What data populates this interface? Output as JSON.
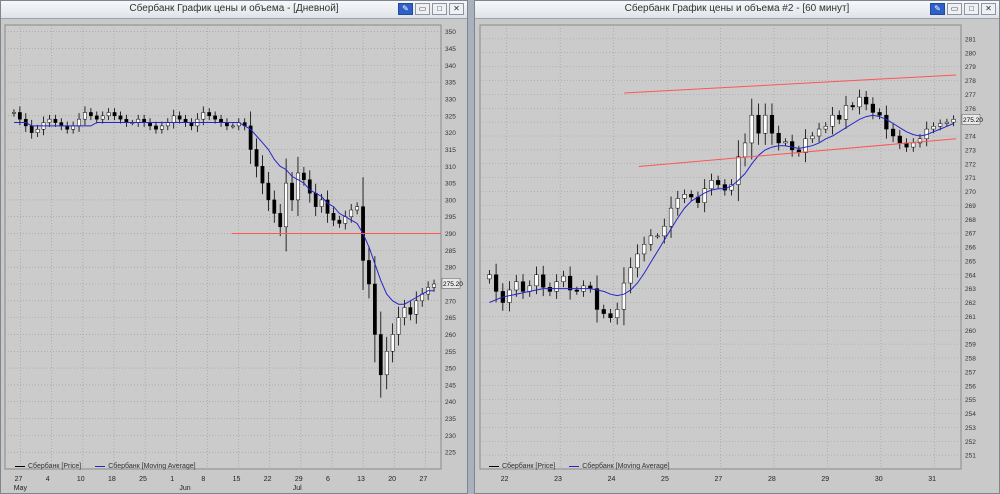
{
  "chart_data": [
    {
      "type": "candlestick",
      "title": "Сбербанк График цены и объема - [Дневной]",
      "ylim": [
        220,
        352
      ],
      "y_ticks": [
        225,
        230,
        235,
        240,
        245,
        250,
        255,
        260,
        265,
        270,
        275,
        280,
        285,
        290,
        295,
        300,
        305,
        310,
        315,
        320,
        325,
        330,
        335,
        340,
        345,
        350
      ],
      "last_value_label": "275.20",
      "x_ticks": [
        "27",
        "4",
        "10",
        "18",
        "25",
        "1",
        "8",
        "15",
        "22",
        "29",
        "6",
        "13",
        "20",
        "27"
      ],
      "x_months": [
        "May",
        "Jun",
        "Jul"
      ],
      "horizontal_line": {
        "y": 290,
        "color": "#ff5555"
      },
      "series": [
        {
          "name": "Сбербанк [Price]",
          "color": "#000000",
          "close": [
            326,
            324,
            322,
            320,
            321,
            323,
            324,
            323,
            322,
            321,
            322,
            324,
            326,
            325,
            324,
            325,
            326,
            325,
            324,
            323,
            323,
            324,
            323,
            322,
            321,
            322,
            323,
            325,
            324,
            323,
            322,
            324,
            326,
            325,
            324,
            323,
            322,
            322,
            323,
            322,
            315,
            310,
            305,
            300,
            296,
            292,
            305,
            300,
            308,
            306,
            302,
            298,
            300,
            296,
            294,
            293,
            295,
            297,
            298,
            282,
            275,
            260,
            248,
            255,
            260,
            265,
            268,
            266,
            270,
            272,
            274,
            275
          ]
        },
        {
          "name": "Сбербанк [Moving Average]",
          "color": "#2525cc",
          "values": [
            323,
            323,
            323,
            322,
            322,
            322,
            322,
            322,
            322,
            322,
            322,
            322,
            322,
            322,
            323,
            323,
            323,
            323,
            323,
            323,
            323,
            323,
            323,
            323,
            323,
            323,
            323,
            323,
            323,
            323,
            323,
            323,
            323,
            323,
            323,
            323,
            323,
            323,
            323,
            322,
            321,
            319,
            317,
            315,
            312,
            310,
            309,
            307,
            306,
            305,
            303,
            302,
            301,
            299,
            298,
            296,
            295,
            294,
            293,
            290,
            286,
            281,
            276,
            272,
            270,
            269,
            269,
            270,
            271,
            272,
            273,
            273
          ]
        }
      ],
      "legend": [
        "Сбербанк [Price]",
        "Сбербанк [Moving Average]"
      ],
      "grid": true
    },
    {
      "type": "candlestick",
      "title": "Сбербанк График цены и объема #2 - [60 минут]",
      "ylim": [
        250,
        282
      ],
      "y_ticks": [
        251,
        252,
        253,
        254,
        255,
        256,
        257,
        258,
        259,
        260,
        261,
        262,
        263,
        264,
        265,
        266,
        267,
        268,
        269,
        270,
        271,
        272,
        273,
        274,
        275,
        276,
        277,
        278,
        279,
        280,
        281
      ],
      "last_value_label": "275.20",
      "x_ticks": [
        "22",
        "23",
        "24",
        "25",
        "27",
        "28",
        "29",
        "30",
        "31"
      ],
      "channel_lines": [
        {
          "from": [
            0.3,
            277.1
          ],
          "to": [
            0.99,
            278.4
          ],
          "color": "#ff5555"
        },
        {
          "from": [
            0.33,
            271.8
          ],
          "to": [
            0.99,
            273.8
          ],
          "color": "#ff5555"
        }
      ],
      "series": [
        {
          "name": "Сбербанк [Price]",
          "color": "#000000",
          "close": [
            264,
            262.8,
            262,
            262.9,
            263.5,
            262.8,
            263.2,
            264,
            263.1,
            262.8,
            263.5,
            263.9,
            262.9,
            262.8,
            263.2,
            263,
            261.5,
            261.2,
            260.9,
            261.5,
            263.4,
            264.5,
            265.5,
            266.2,
            266.8,
            266.8,
            267.5,
            268.8,
            269.5,
            269.8,
            269.6,
            269.2,
            270.2,
            270.8,
            270.5,
            270.1,
            270.5,
            272.5,
            273.5,
            275.5,
            274.2,
            275.5,
            274.2,
            273.5,
            273.6,
            273,
            272.8,
            273.8,
            274,
            274.5,
            274.7,
            275.5,
            275.2,
            276.2,
            276.1,
            276.8,
            276.3,
            275.7,
            275.5,
            274.5,
            274,
            273.5,
            273.2,
            273.5,
            273.8,
            274.5,
            274.7,
            274.9,
            275,
            275.2
          ]
        },
        {
          "name": "Сбербанк [Moving Average]",
          "color": "#2525cc",
          "values": [
            262,
            262.2,
            262.4,
            262.5,
            262.6,
            262.7,
            262.8,
            262.9,
            263,
            263,
            263,
            263,
            263,
            263,
            263,
            263,
            262.9,
            262.8,
            262.6,
            262.5,
            262.6,
            262.9,
            263.4,
            264.1,
            264.9,
            265.7,
            266.5,
            267.3,
            268.1,
            268.8,
            269.3,
            269.6,
            269.9,
            270.1,
            270.2,
            270.2,
            270.4,
            270.8,
            271.3,
            272,
            272.6,
            273,
            273.2,
            273.3,
            273.3,
            273.2,
            273.1,
            273.2,
            273.3,
            273.5,
            273.8,
            274,
            274.3,
            274.6,
            274.9,
            275.2,
            275.4,
            275.5,
            275.4,
            275.2,
            274.9,
            274.6,
            274.3,
            274.1,
            274,
            274.1,
            274.3,
            274.5,
            274.7,
            274.9
          ]
        }
      ],
      "legend": [
        "Сбербанк [Price]",
        "Сбербанк [Moving Average]"
      ],
      "grid": true
    }
  ]
}
